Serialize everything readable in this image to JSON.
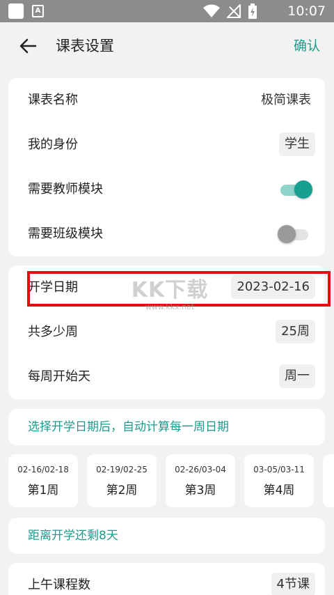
{
  "status_bar": {
    "time": "10:07",
    "a_label": "A"
  },
  "header": {
    "title": "课表设置",
    "confirm": "确认"
  },
  "basic": {
    "name_label": "课表名称",
    "name_value": "极简课表",
    "identity_label": "我的身份",
    "identity_value": "学生",
    "teacher_label": "需要教师模块",
    "teacher_on": true,
    "class_label": "需要班级模块",
    "class_on": false
  },
  "term": {
    "start_label": "开学日期",
    "start_value": "2023-02-16",
    "weeks_label": "共多少周",
    "weeks_value": "25周",
    "weekstart_label": "每周开始天",
    "weekstart_value": "周一"
  },
  "watermark": {
    "main": "KK下载",
    "sub": "www.kkx.net"
  },
  "auto_calc_text": "选择开学日期后，自动计算每一周日期",
  "weeks": [
    {
      "range": "02-16/02-18",
      "label": "第1周"
    },
    {
      "range": "02-19/02-25",
      "label": "第2周"
    },
    {
      "range": "02-26/03-04",
      "label": "第3周"
    },
    {
      "range": "03-05/03-11",
      "label": "第4周"
    }
  ],
  "countdown_text": "距离开学还剩8天",
  "morning": {
    "label": "上午课程数",
    "value": "4节课"
  },
  "colors": {
    "accent": "#1a9c8c",
    "highlight": "#e01010",
    "status_bar": "#8c8c8c"
  }
}
